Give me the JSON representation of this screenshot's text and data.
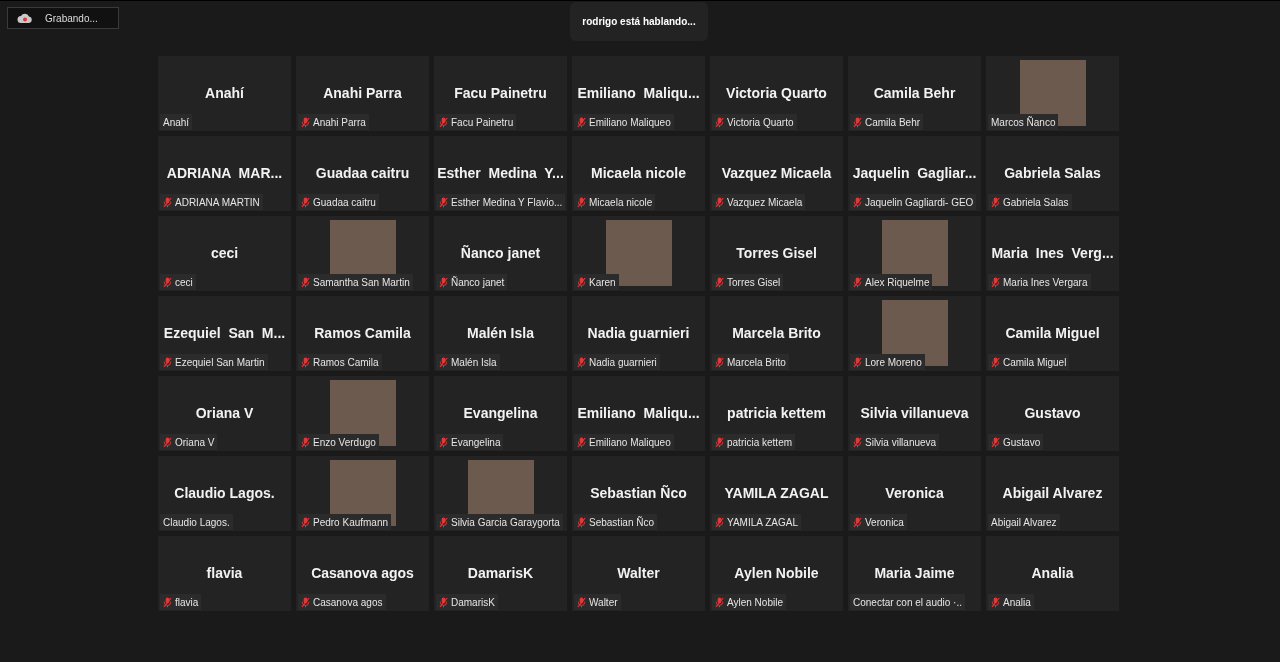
{
  "recording": {
    "label": "Grabando..."
  },
  "speaker_banner": "rodrigo está hablando...",
  "tiles": [
    {
      "kind": "name",
      "display_name": "Anahí",
      "label": "Anahí",
      "muted": false
    },
    {
      "kind": "name",
      "display_name": "Anahi Parra",
      "label": "Anahi Parra",
      "muted": true
    },
    {
      "kind": "name",
      "display_name": "Facu Painetru",
      "label": "Facu Painetru",
      "muted": true
    },
    {
      "kind": "name",
      "display_name": "Emiliano  Maliqu...",
      "label": "Emiliano Maliqueo",
      "muted": true
    },
    {
      "kind": "name",
      "display_name": "Victoria Quarto",
      "label": "Victoria Quarto",
      "muted": true
    },
    {
      "kind": "name",
      "display_name": "Camila Behr",
      "label": "Camila Behr",
      "muted": true
    },
    {
      "kind": "video",
      "label": "Marcos Ñanco",
      "muted": false
    },
    {
      "kind": "name",
      "display_name": "ADRIANA  MAR...",
      "label": "ADRIANA MARTIN",
      "muted": true
    },
    {
      "kind": "name",
      "display_name": "Guadaa caitru",
      "label": "Guadaa caitru",
      "muted": true
    },
    {
      "kind": "name",
      "display_name": "Esther  Medina  Y...",
      "label": "Esther Medina Y Flavio...",
      "muted": true
    },
    {
      "kind": "name",
      "display_name": "Micaela nicole",
      "label": "Micaela nicole",
      "muted": true
    },
    {
      "kind": "name",
      "display_name": "Vazquez Micaela",
      "label": "Vazquez Micaela",
      "muted": true
    },
    {
      "kind": "name",
      "display_name": "Jaquelin  Gagliar...",
      "label": "Jaquelin Gagliardi- GEO",
      "muted": true
    },
    {
      "kind": "name",
      "display_name": "Gabriela Salas",
      "label": "Gabriela Salas",
      "muted": true
    },
    {
      "kind": "name",
      "display_name": "ceci",
      "label": "ceci",
      "muted": true
    },
    {
      "kind": "video",
      "label": "Samantha San Martin",
      "muted": true
    },
    {
      "kind": "name",
      "display_name": "Ñanco janet",
      "label": "Ñanco janet",
      "muted": true
    },
    {
      "kind": "video",
      "label": "Karen",
      "muted": true
    },
    {
      "kind": "name",
      "display_name": "Torres Gisel",
      "label": "Torres Gisel",
      "muted": true
    },
    {
      "kind": "video",
      "label": "Alex Riquelme",
      "muted": true
    },
    {
      "kind": "name",
      "display_name": "Maria  Ines  Verg...",
      "label": "Maria Ines Vergara",
      "muted": true
    },
    {
      "kind": "name",
      "display_name": "Ezequiel  San  M...",
      "label": "Ezequiel San Martin",
      "muted": true
    },
    {
      "kind": "name",
      "display_name": "Ramos Camila",
      "label": "Ramos Camila",
      "muted": true
    },
    {
      "kind": "name",
      "display_name": "Malén Isla",
      "label": "Malén Isla",
      "muted": true
    },
    {
      "kind": "name",
      "display_name": "Nadia guarnieri",
      "label": "Nadia guarnieri",
      "muted": true
    },
    {
      "kind": "name",
      "display_name": "Marcela Brito",
      "label": "Marcela Brito",
      "muted": true
    },
    {
      "kind": "video",
      "label": "Lore Moreno",
      "muted": true
    },
    {
      "kind": "name",
      "display_name": "Camila Miguel",
      "label": "Camila Miguel",
      "muted": true
    },
    {
      "kind": "name",
      "display_name": "Oriana V",
      "label": "Oriana V",
      "muted": true
    },
    {
      "kind": "video",
      "label": "Enzo Verdugo",
      "muted": true
    },
    {
      "kind": "name",
      "display_name": "Evangelina",
      "label": "Evangelina",
      "muted": true
    },
    {
      "kind": "name",
      "display_name": "Emiliano  Maliqu...",
      "label": "Emiliano Maliqueo",
      "muted": true
    },
    {
      "kind": "name",
      "display_name": "patricia kettem",
      "label": "patricia kettem",
      "muted": true
    },
    {
      "kind": "name",
      "display_name": "Silvia villanueva",
      "label": "Silvia villanueva",
      "muted": true
    },
    {
      "kind": "name",
      "display_name": "Gustavo",
      "label": "Gustavo",
      "muted": true
    },
    {
      "kind": "name",
      "display_name": "Claudio Lagos.",
      "label": "Claudio Lagos.",
      "muted": false
    },
    {
      "kind": "video",
      "label": "Pedro Kaufmann",
      "muted": true
    },
    {
      "kind": "video",
      "label": "Silvia Garcia Garaygorta",
      "muted": true
    },
    {
      "kind": "name",
      "display_name": "Sebastian Ñco",
      "label": "Sebastian Ñco",
      "muted": true
    },
    {
      "kind": "name",
      "display_name": "YAMILA ZAGAL",
      "label": "YAMILA ZAGAL",
      "muted": true
    },
    {
      "kind": "name",
      "display_name": "Veronica",
      "label": "Veronica",
      "muted": true
    },
    {
      "kind": "name",
      "display_name": "Abigail Alvarez",
      "label": "Abigail Alvarez",
      "muted": false
    },
    {
      "kind": "name",
      "display_name": "flavia",
      "label": "flavia",
      "muted": true
    },
    {
      "kind": "name",
      "display_name": "Casanova agos",
      "label": "Casanova agos",
      "muted": true
    },
    {
      "kind": "name",
      "display_name": "DamarisK",
      "label": "DamarisK",
      "muted": true
    },
    {
      "kind": "name",
      "display_name": "Walter",
      "label": "Walter",
      "muted": true
    },
    {
      "kind": "name",
      "display_name": "Aylen Nobile",
      "label": "Aylen Nobile",
      "muted": true
    },
    {
      "kind": "name",
      "display_name": "Maria Jaime",
      "label": "Conectar con el audio ·..",
      "muted": false
    },
    {
      "kind": "name",
      "display_name": "Analia",
      "label": "Analia",
      "muted": true
    }
  ]
}
